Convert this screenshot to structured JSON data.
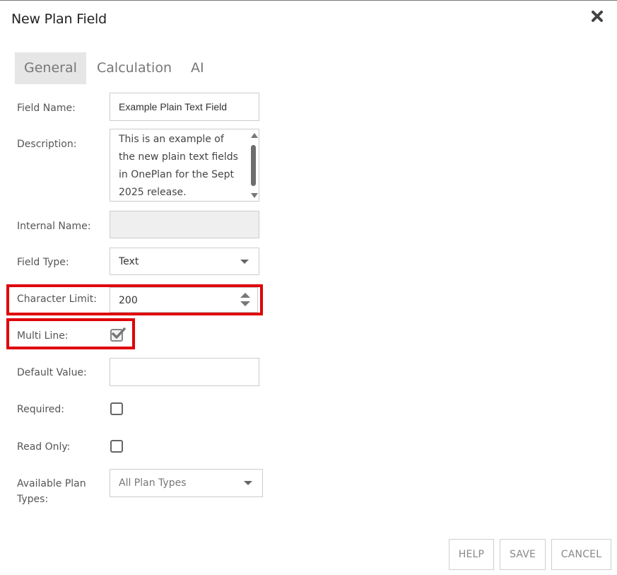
{
  "dialog": {
    "title": "New Plan Field"
  },
  "tabs": [
    {
      "label": "General",
      "active": true
    },
    {
      "label": "Calculation",
      "active": false
    },
    {
      "label": "AI",
      "active": false
    }
  ],
  "fields": {
    "field_name": {
      "label": "Field Name:",
      "value": "Example Plain Text Field"
    },
    "description": {
      "label": "Description:",
      "value": "This is an example of\nthe new plain text fields\nin OnePlan for the Sept\n2025 release."
    },
    "internal_name": {
      "label": "Internal Name:",
      "value": ""
    },
    "field_type": {
      "label": "Field Type:",
      "value": "Text"
    },
    "character_limit": {
      "label": "Character Limit:",
      "value": "200"
    },
    "multi_line": {
      "label": "Multi Line:",
      "checked": true
    },
    "default_value": {
      "label": "Default Value:",
      "value": ""
    },
    "required": {
      "label": "Required:",
      "checked": false
    },
    "read_only": {
      "label": "Read Only:",
      "checked": false
    },
    "available_plan_types": {
      "label": "Available Plan\nTypes:",
      "value": "All Plan Types"
    }
  },
  "buttons": {
    "help": "HELP",
    "save": "SAVE",
    "cancel": "CANCEL"
  },
  "colors": {
    "highlight": "#e0000b",
    "active_tab_bg": "#e6e6e6"
  },
  "icons": {
    "close": "close-icon",
    "checkmark": "checkmark-icon"
  }
}
